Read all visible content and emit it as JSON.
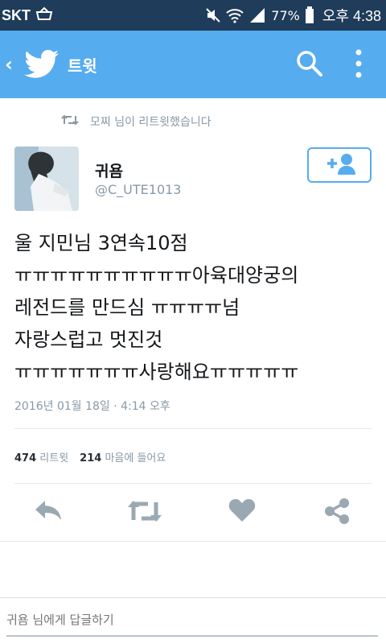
{
  "status_bar": {
    "carrier": "SKT",
    "battery": "77%",
    "time": "오후 4:38"
  },
  "app_bar": {
    "title": "트윗"
  },
  "retweet_notice": "모찌 님이 리트윗했습니다",
  "author": {
    "name": "귀욤",
    "handle": "@C_UTE1013"
  },
  "tweet": {
    "lines": [
      "울 지민님 3연속10점",
      "ㅠㅠㅠㅠㅠㅠㅠㅠㅠㅠ아육대양궁의",
      "레전드를 만드심 ㅠㅠㅠㅠ넘",
      "자랑스럽고 멋진것",
      "ㅠㅠㅠㅠㅠㅠㅠ사랑해요ㅠㅠㅠㅠㅠ"
    ],
    "timestamp": "2016년 01월 18일 · 4:14 오후"
  },
  "stats": {
    "retweets_count": "474",
    "retweets_label": "리트윗",
    "likes_count": "214",
    "likes_label": "마음에 들어요"
  },
  "reply": {
    "placeholder": "귀욤 님에게 답글하기"
  },
  "colors": {
    "status_bar": "#1f3c5a",
    "app_bar": "#55acee",
    "icon_gray": "#9aa8b2",
    "muted_text": "#8899a6"
  }
}
